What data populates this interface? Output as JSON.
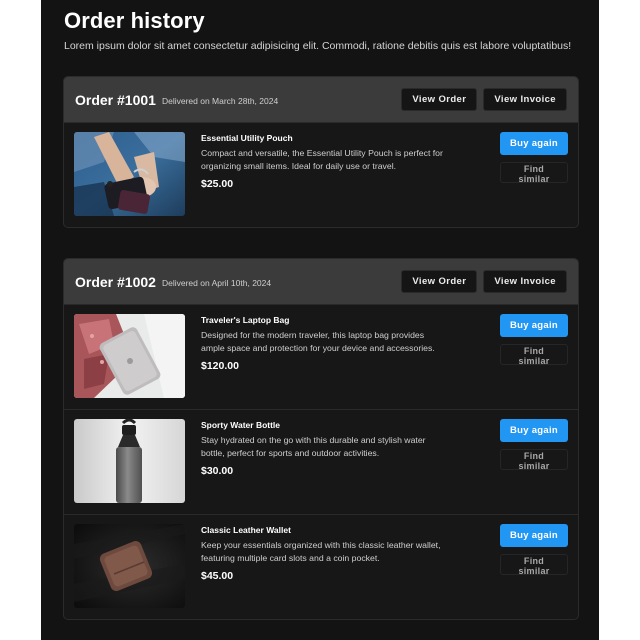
{
  "page": {
    "title": "Order history",
    "subtitle": "Lorem ipsum dolor sit amet consectetur adipisicing elit. Commodi, ratione debitis quis est labore voluptatibus!"
  },
  "colors": {
    "panel_bg": "#131313",
    "header_bg": "#3b3b3b",
    "accent": "#2196f3"
  },
  "buttons": {
    "view_order": "View Order",
    "view_invoice": "View Invoice",
    "buy_again": "Buy again",
    "find_similar": "Find similar"
  },
  "orders": [
    {
      "title": "Order #1001",
      "date": "Delivered on March 28th, 2024",
      "items": [
        {
          "name": "Essential Utility Pouch",
          "description": "Compact and versatile, the Essential Utility Pouch is perfect for organizing small items. Ideal for daily use or travel.",
          "price": "$25.00",
          "image_icon": "person-holding-pouch-photo"
        }
      ]
    },
    {
      "title": "Order #1002",
      "date": "Delivered on April 10th, 2024",
      "items": [
        {
          "name": "Traveler's Laptop Bag",
          "description": "Designed for the modern traveler, this laptop bag provides ample space and protection for your device and accessories.",
          "price": "$120.00",
          "image_icon": "laptop-bag-photo"
        },
        {
          "name": "Sporty Water Bottle",
          "description": "Stay hydrated on the go with this durable and stylish water bottle, perfect for sports and outdoor activities.",
          "price": "$30.00",
          "image_icon": "water-bottle-photo"
        },
        {
          "name": "Classic Leather Wallet",
          "description": "Keep your essentials organized with this classic leather wallet, featuring multiple card slots and a coin pocket.",
          "price": "$45.00",
          "image_icon": "leather-wallet-photo"
        }
      ]
    }
  ]
}
